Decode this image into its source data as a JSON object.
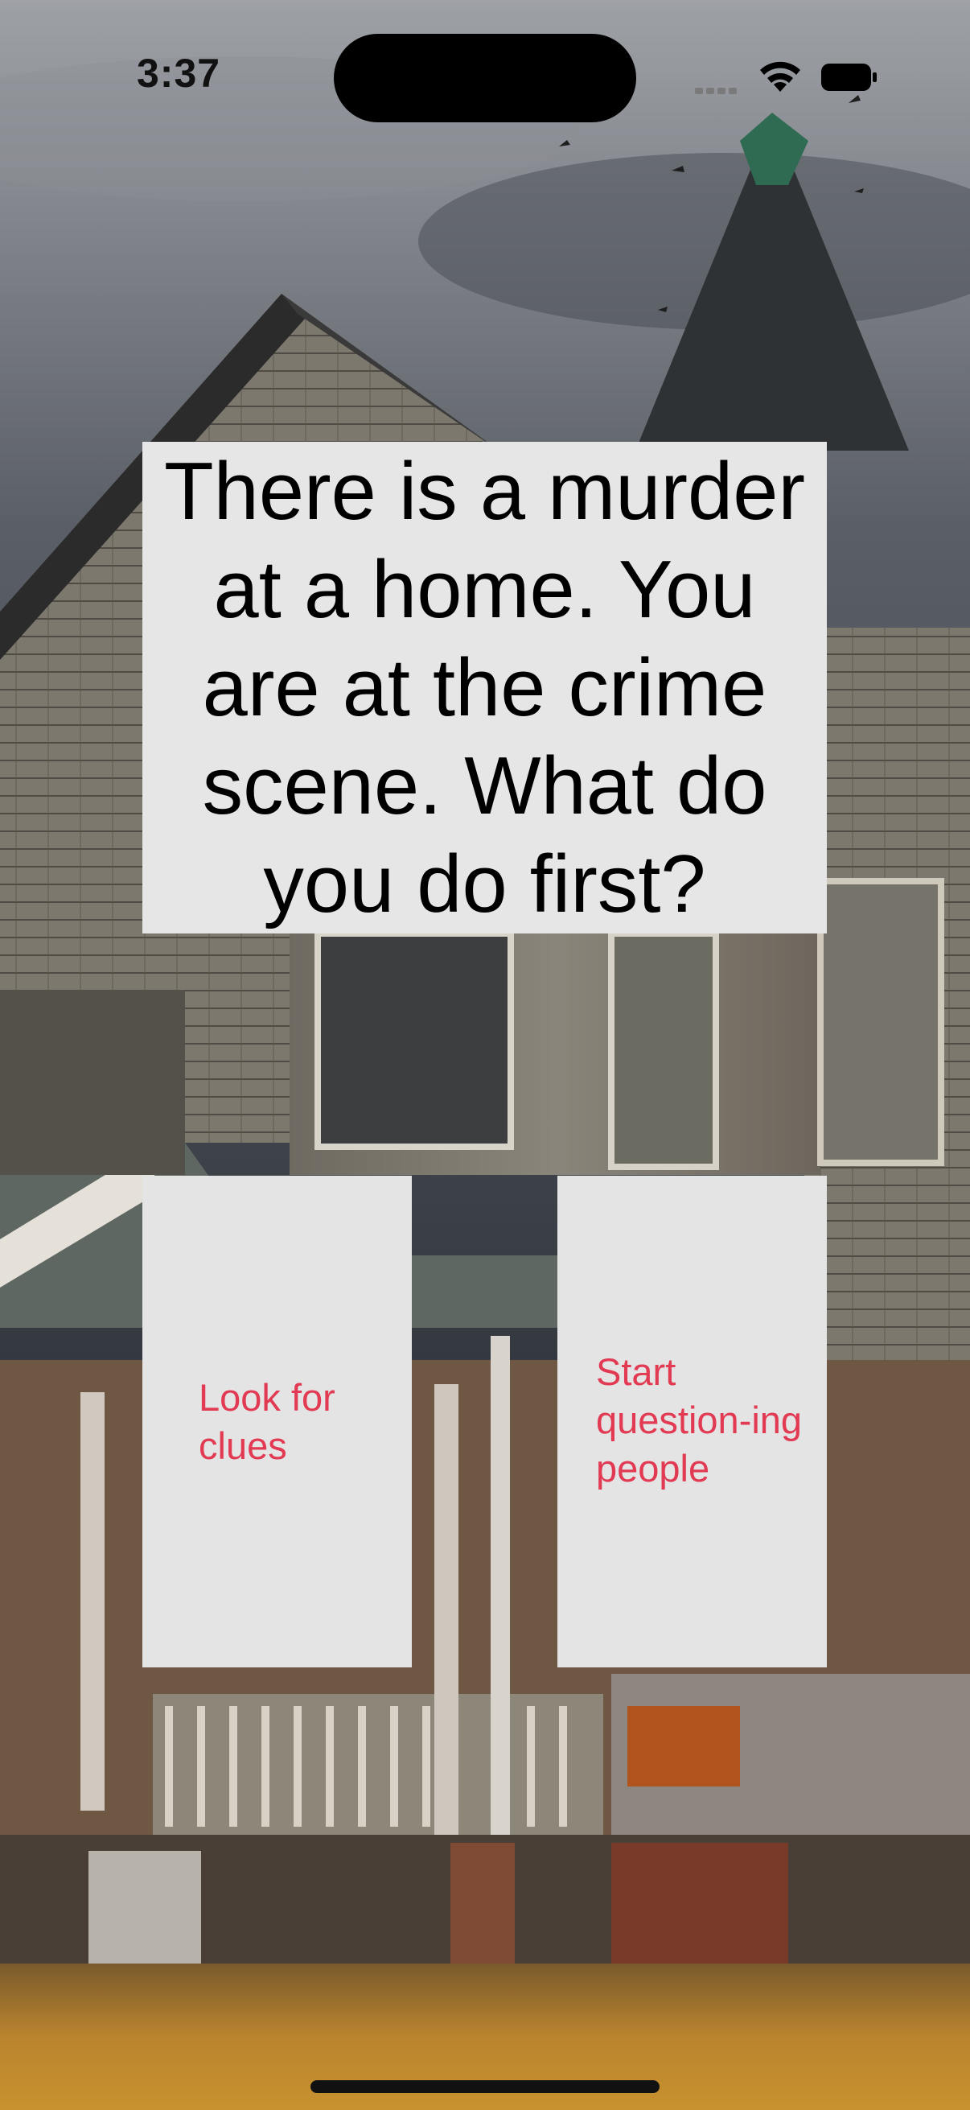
{
  "status_bar": {
    "time": "3:37"
  },
  "background": {
    "subject": "haunted-house-photo"
  },
  "prompt": {
    "text": "There is a murder at a home. You are at the crime scene. What do you do first?"
  },
  "choices": [
    {
      "label": "Look for clues"
    },
    {
      "label": "Start question-ing people"
    }
  ],
  "colors": {
    "panel": "#e6e6e6",
    "choice_text": "#e23a52",
    "prompt_text": "#000000"
  }
}
